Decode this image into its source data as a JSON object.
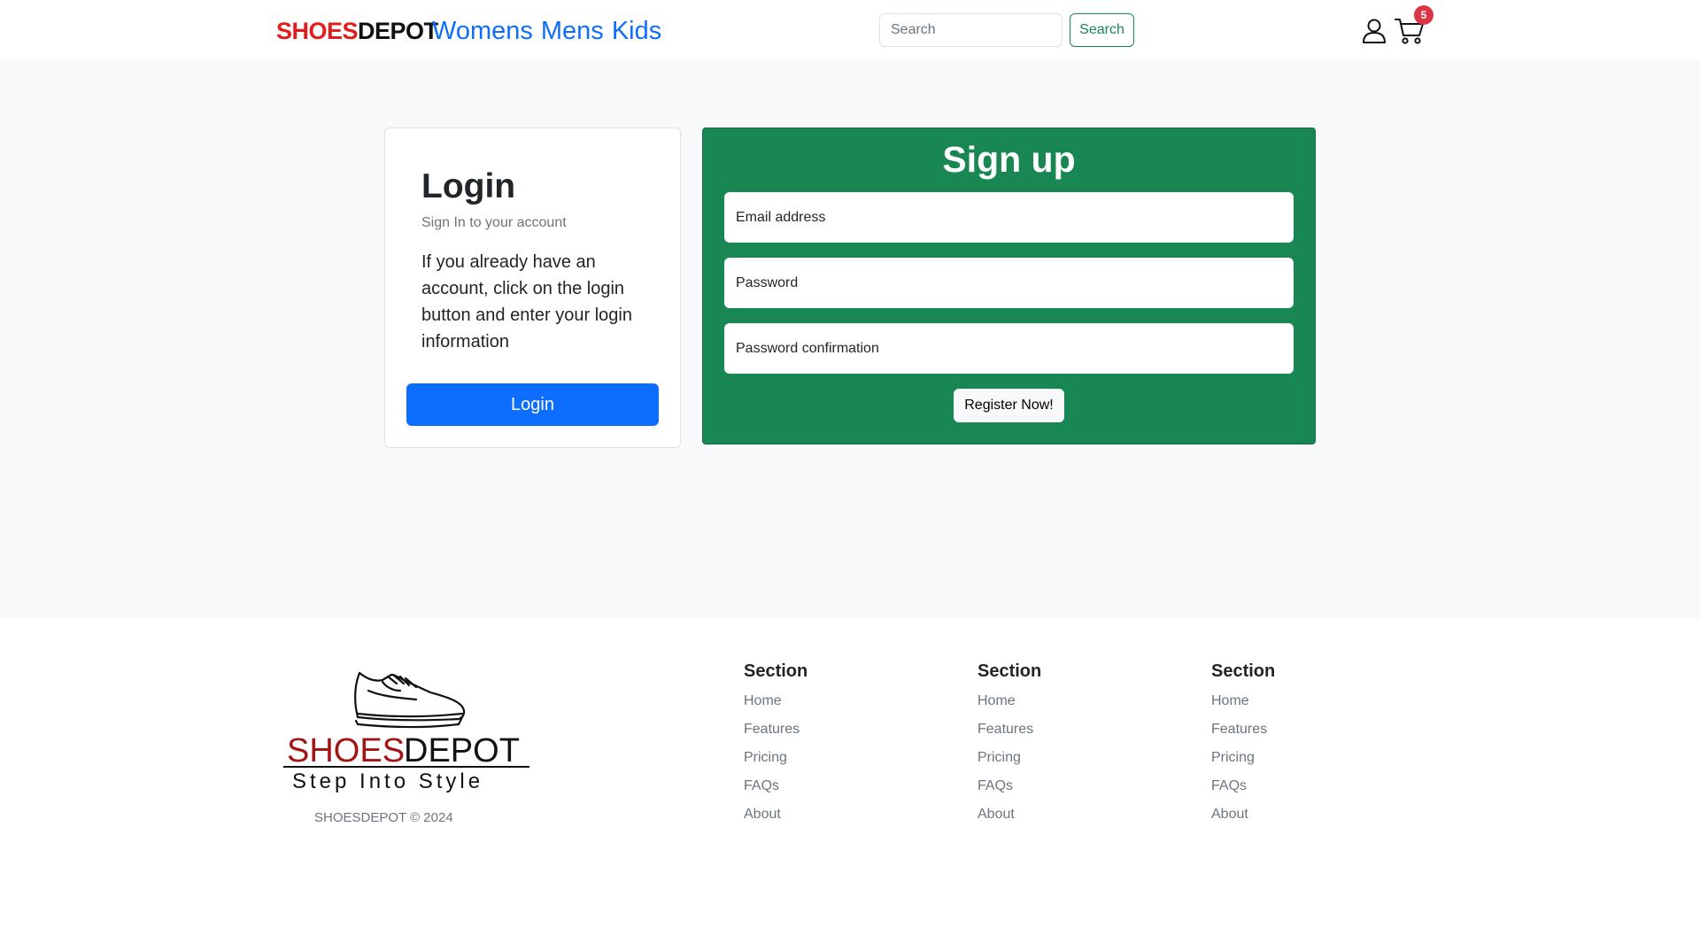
{
  "navbar": {
    "brand_part1": "SHOES",
    "brand_part2": "DEPOT",
    "links": [
      "Womens",
      "Mens",
      "Kids"
    ],
    "search_placeholder": "Search",
    "search_button": "Search",
    "cart_count": "5",
    "colors": {
      "brand_red": "#e21d1d",
      "link_blue": "#0d6efd",
      "badge_red": "#dc3545",
      "accent_green": "#198754"
    }
  },
  "login": {
    "title": "Login",
    "subtitle": "Sign In to your account",
    "text": "If you already have an account, click on the login button and enter your login information",
    "button": "Login"
  },
  "signup": {
    "title": "Sign up",
    "email_placeholder": "Email address",
    "password_placeholder": "Password",
    "confirm_placeholder": "Password confirmation",
    "button": "Register Now!"
  },
  "footer": {
    "logo_brand_part1": "SHOES",
    "logo_brand_part2": "DEPOT",
    "logo_tagline": "Step Into Style",
    "copyright": "SHOESDEPOT © 2024",
    "columns": [
      {
        "heading": "Section",
        "links": [
          "Home",
          "Features",
          "Pricing",
          "FAQs",
          "About"
        ]
      },
      {
        "heading": "Section",
        "links": [
          "Home",
          "Features",
          "Pricing",
          "FAQs",
          "About"
        ]
      },
      {
        "heading": "Section",
        "links": [
          "Home",
          "Features",
          "Pricing",
          "FAQs",
          "About"
        ]
      }
    ]
  }
}
